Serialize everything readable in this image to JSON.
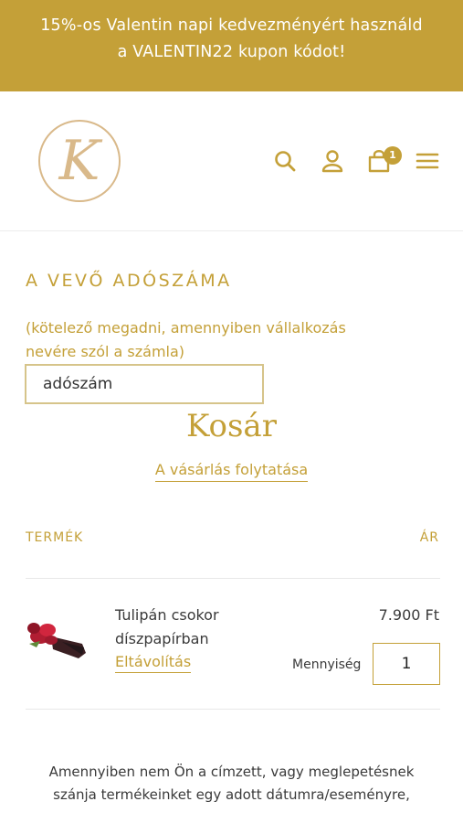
{
  "banner": {
    "line1": "15%-os Valentin napi kedvezményért használd",
    "line2": "a VALENTIN22 kupon kódot!"
  },
  "header": {
    "logo_letter": "K",
    "cart_count": "1",
    "icons": [
      "search-icon",
      "account-icon",
      "cart-icon",
      "menu-icon"
    ]
  },
  "tax": {
    "title": "A VEVŐ ADÓSZÁMA",
    "help_line1": "(kötelező megadni, amennyiben vállalkozás",
    "help_line2": "nevére szól a számla)",
    "input_value": "adószám"
  },
  "cart": {
    "title": "Kosár",
    "continue_label": "A vásárlás folytatása",
    "col_product": "TERMÉK",
    "col_price": "ÁR"
  },
  "items": [
    {
      "name_line1": "Tulipán csokor",
      "name_line2": "díszpapírban",
      "remove_label": "Eltávolítás",
      "price": "7.900 Ft",
      "qty_label": "Mennyiség",
      "qty": "1"
    }
  ],
  "note": {
    "line1": "Amennyiben nem Ön a címzett, vagy meglepetésnek",
    "line2": "szánja termékeinket egy adott dátumra/eseményre,"
  },
  "colors": {
    "accent": "#c4a038",
    "text": "#3a3a3a"
  }
}
